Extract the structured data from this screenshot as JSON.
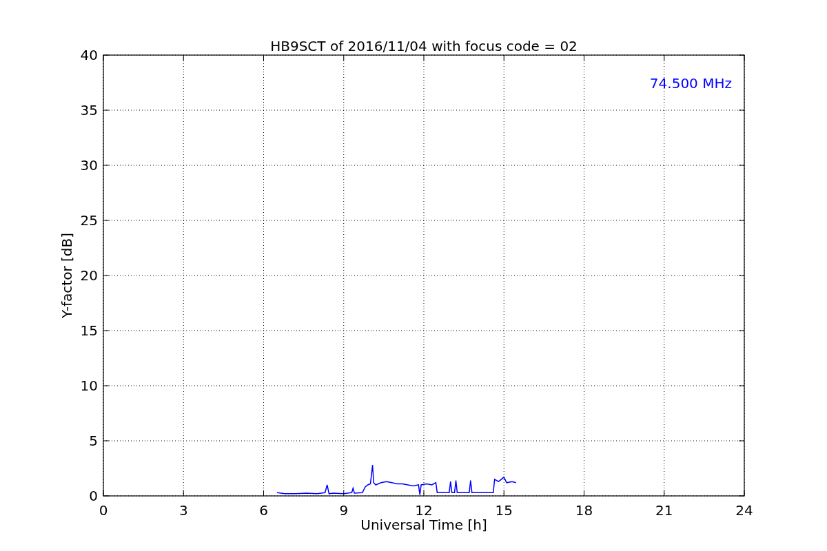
{
  "chart_data": {
    "type": "line",
    "title": "HB9SCT of 2016/11/04 with focus code = 02",
    "xlabel": "Universal Time [h]",
    "ylabel": "Y-factor [dB]",
    "x": [
      6.5,
      6.8,
      7.2,
      7.6,
      8.0,
      8.3,
      8.38,
      8.45,
      8.6,
      9.0,
      9.3,
      9.35,
      9.4,
      9.7,
      9.8,
      9.9,
      10.0,
      10.08,
      10.12,
      10.2,
      10.4,
      10.6,
      10.8,
      11.0,
      11.2,
      11.4,
      11.6,
      11.8,
      11.85,
      11.9,
      12.1,
      12.3,
      12.45,
      12.5,
      12.7,
      12.95,
      13.0,
      13.05,
      13.15,
      13.2,
      13.25,
      13.5,
      13.7,
      13.75,
      13.8,
      14.0,
      14.3,
      14.6,
      14.65,
      14.8,
      15.0,
      15.1,
      15.3,
      15.45
    ],
    "series": [
      {
        "color": "#0000ff",
        "values": [
          0.3,
          0.2,
          0.2,
          0.25,
          0.2,
          0.3,
          1.0,
          0.2,
          0.25,
          0.2,
          0.3,
          0.7,
          0.25,
          0.3,
          0.8,
          1.0,
          1.1,
          2.8,
          1.2,
          1.0,
          1.2,
          1.3,
          1.2,
          1.1,
          1.1,
          1.0,
          0.9,
          1.0,
          0.1,
          1.0,
          1.1,
          1.0,
          1.2,
          0.3,
          0.3,
          0.3,
          1.3,
          0.3,
          0.3,
          1.4,
          0.3,
          0.3,
          0.3,
          1.4,
          0.3,
          0.3,
          0.3,
          0.3,
          1.5,
          1.3,
          1.7,
          1.2,
          1.3,
          1.2
        ]
      }
    ],
    "xlim": [
      0,
      24
    ],
    "ylim": [
      0,
      40
    ],
    "xticks": [
      0,
      3,
      6,
      9,
      12,
      15,
      18,
      21,
      24
    ],
    "yticks": [
      0,
      5,
      10,
      15,
      20,
      25,
      30,
      35,
      40
    ],
    "grid": true,
    "annotations": [
      {
        "text": "74.500 MHz"
      }
    ]
  }
}
